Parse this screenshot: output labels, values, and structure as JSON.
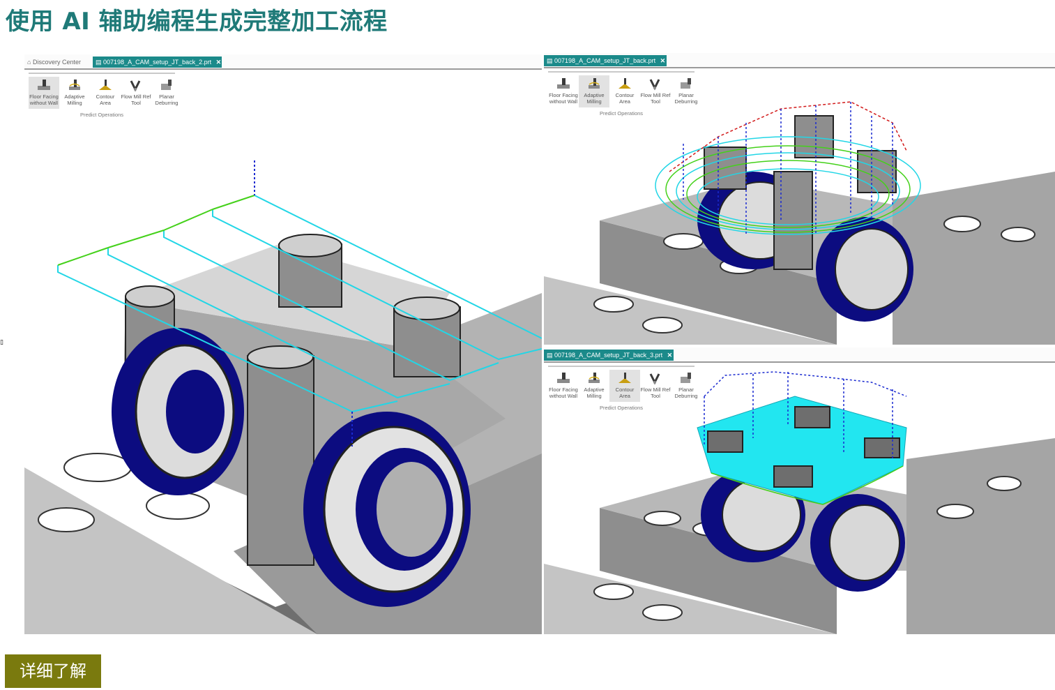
{
  "page": {
    "title": "使用 AI 辅助编程生成完整加工流程",
    "cta_label": "详细了解"
  },
  "colors": {
    "title": "#1f7a78",
    "cta_bg": "#7a7a0e",
    "tab_active": "#1b8a8a",
    "steel_light": "#c9c9c9",
    "steel_dark": "#7c7c7c",
    "part_shadow": "#0c0c80",
    "toolpath_cyan": "#22d6e6",
    "toolpath_green": "#44d11a",
    "rapid_blue": "#1a2ad0",
    "rapid_red": "#d21a1a"
  },
  "panels": [
    {
      "tabs": [
        {
          "label": "Discovery Center",
          "icon": "home-icon",
          "active": false
        },
        {
          "label": "007198_A_CAM_setup_JT_back_2.prt",
          "icon": "part-icon",
          "active": true
        }
      ],
      "ribbon": {
        "group_label": "Predict Operations",
        "buttons": [
          {
            "label": "Floor Facing without Wall",
            "icon": "floor-facing-icon",
            "selected": true
          },
          {
            "label": "Adaptive Milling",
            "icon": "adaptive-milling-icon",
            "selected": false
          },
          {
            "label": "Contour Area",
            "icon": "contour-area-icon",
            "selected": false
          },
          {
            "label": "Flow Mill Ref Tool",
            "icon": "flow-mill-icon",
            "selected": false
          },
          {
            "label": "Planar Deburring",
            "icon": "planar-deburring-icon",
            "selected": false
          }
        ]
      },
      "toolpath": "floor-facing"
    },
    {
      "tabs": [
        {
          "label": "007198_A_CAM_setup_JT_back.prt",
          "icon": "part-icon",
          "active": true
        }
      ],
      "ribbon": {
        "group_label": "Predict Operations",
        "buttons": [
          {
            "label": "Floor Facing without Wall",
            "icon": "floor-facing-icon",
            "selected": false
          },
          {
            "label": "Adaptive Milling",
            "icon": "adaptive-milling-icon",
            "selected": true
          },
          {
            "label": "Contour Area",
            "icon": "contour-area-icon",
            "selected": false
          },
          {
            "label": "Flow Mill Ref Tool",
            "icon": "flow-mill-icon",
            "selected": false
          },
          {
            "label": "Planar Deburring",
            "icon": "planar-deburring-icon",
            "selected": false
          }
        ]
      },
      "toolpath": "adaptive-milling"
    },
    {
      "tabs": [
        {
          "label": "007198_A_CAM_setup_JT_back_3.prt",
          "icon": "part-icon",
          "active": true
        }
      ],
      "ribbon": {
        "group_label": "Predict Operations",
        "buttons": [
          {
            "label": "Floor Facing without Wall",
            "icon": "floor-facing-icon",
            "selected": false
          },
          {
            "label": "Adaptive Milling",
            "icon": "adaptive-milling-icon",
            "selected": false
          },
          {
            "label": "Contour Area",
            "icon": "contour-area-icon",
            "selected": true
          },
          {
            "label": "Flow Mill Ref Tool",
            "icon": "flow-mill-icon",
            "selected": false
          },
          {
            "label": "Planar Deburring",
            "icon": "planar-deburring-icon",
            "selected": false
          }
        ]
      },
      "toolpath": "contour-area"
    }
  ]
}
